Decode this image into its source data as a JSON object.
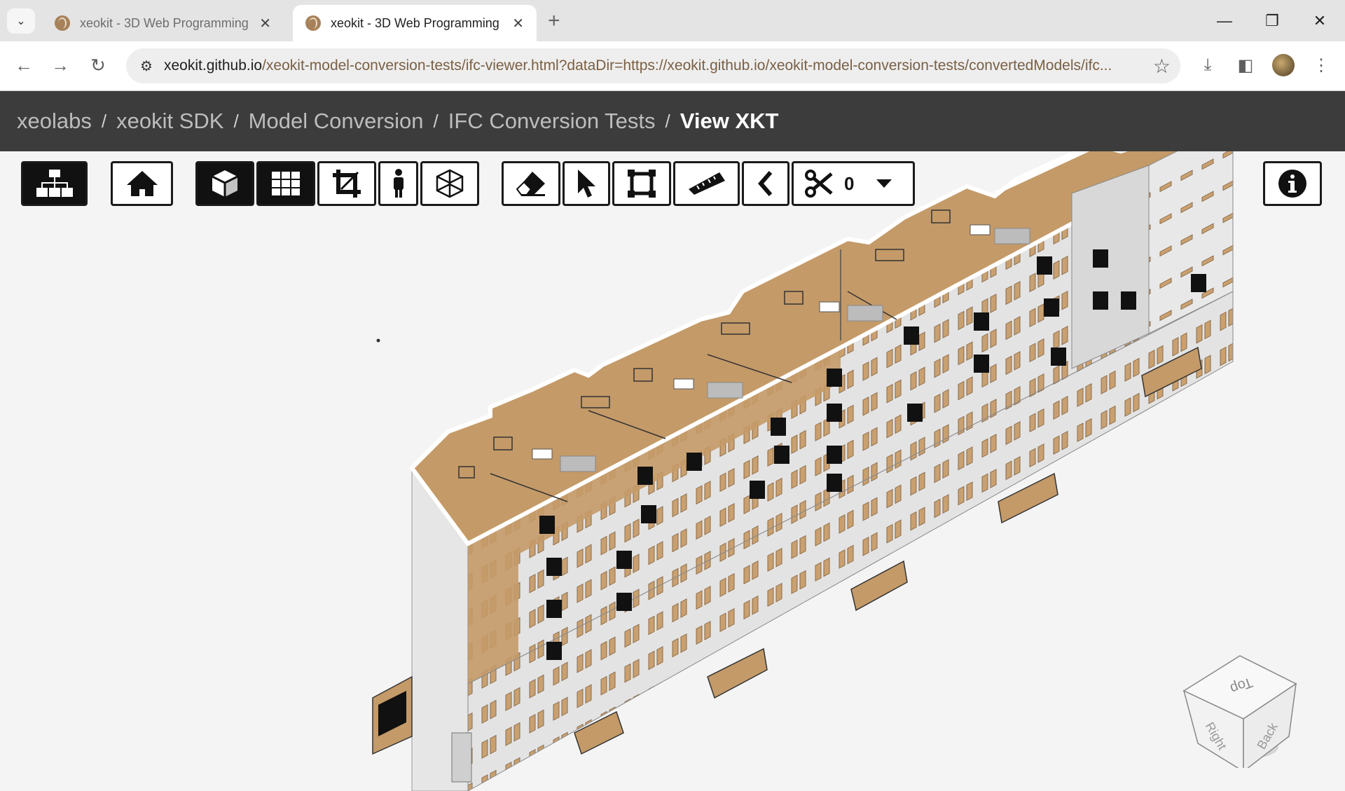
{
  "browser": {
    "tabs": [
      {
        "title": "xeokit - 3D Web Programming",
        "active": false
      },
      {
        "title": "xeokit - 3D Web Programming",
        "active": true
      }
    ],
    "url_host": "xeokit.github.io",
    "url_path": "/xeokit-model-conversion-tests/ifc-viewer.html?dataDir=https://xeokit.github.io/xeokit-model-conversion-tests/convertedModels/ifc..."
  },
  "breadcrumb": {
    "items": [
      "xeolabs",
      "xeokit SDK",
      "Model Conversion",
      "IFC Conversion Tests"
    ],
    "current": "View XKT",
    "separator": "/"
  },
  "toolbar": {
    "section_count": "0",
    "buttons": [
      "explorer",
      "home",
      "3d-mode",
      "ortho-grid",
      "fit-crop",
      "first-person",
      "xray",
      "erase",
      "select",
      "marquee",
      "measure",
      "back",
      "section-planes",
      "info"
    ],
    "active": [
      "explorer",
      "3d-mode",
      "ortho-grid"
    ]
  },
  "navcube": {
    "faces": [
      "Top",
      "Right",
      "Back"
    ]
  },
  "colors": {
    "roof": "#c49a68",
    "wall": "#e3e3e3",
    "window": "#c9a070",
    "balcony": "#111111",
    "header": "#3c3c3c"
  }
}
